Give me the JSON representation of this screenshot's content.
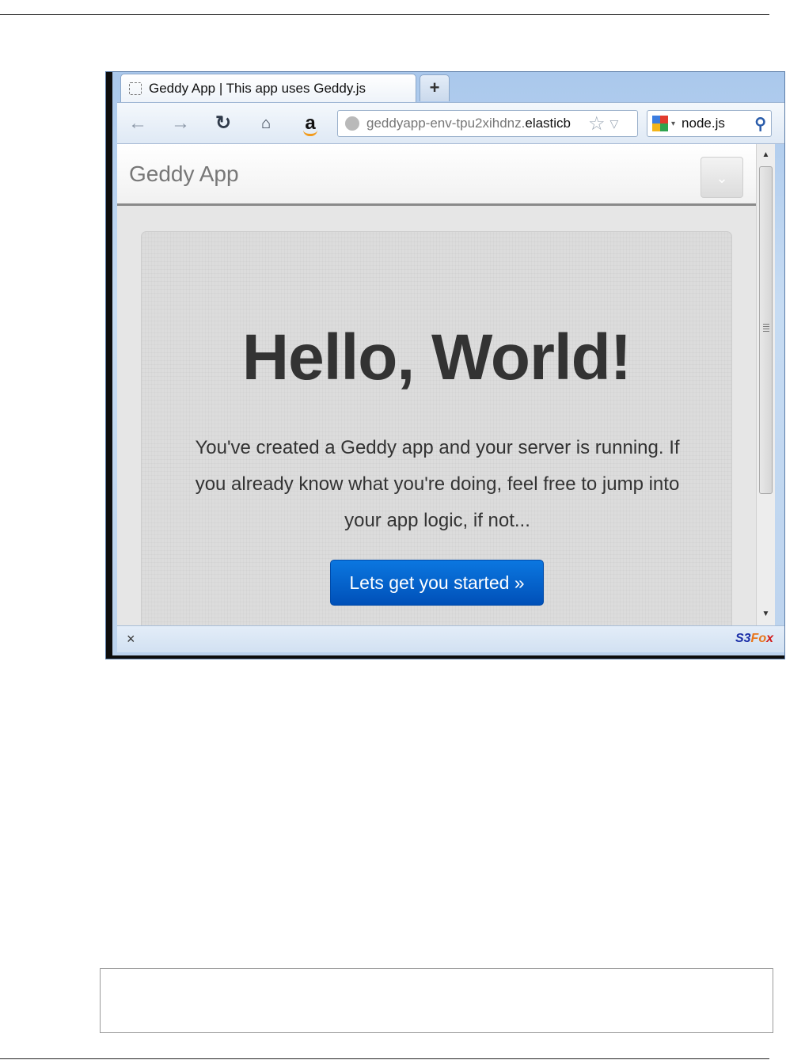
{
  "browser": {
    "tab": {
      "title": "Geddy App | This app uses Geddy.js",
      "favicon": "blank-page-icon"
    },
    "new_tab_label": "+",
    "nav": {
      "back_icon": "←",
      "forward_icon": "→",
      "reload_icon": "↻",
      "home_icon": "⌂",
      "amazon_label": "a"
    },
    "url": {
      "host_prefix": "geddyapp-env-tpu2xihdnz.",
      "host_highlight": "elasticb",
      "star_icon": "☆",
      "dropdown_icon": "▽"
    },
    "search": {
      "value": "node.js",
      "engine_icon": "google-icon",
      "dropdown_icon": "▾",
      "search_icon": "⚲"
    },
    "status": {
      "close_label": "×",
      "addon_s3": "S3",
      "addon_fo": "Fo",
      "addon_x": "x"
    },
    "scrollbar": {
      "up": "▲",
      "down": "▼"
    }
  },
  "page": {
    "brand": "Geddy App",
    "collapse_icon": "⌄",
    "hero": {
      "heading": "Hello, World!",
      "lead": "You've created a Geddy app and your server is running. If you already know what you're doing, feel free to jump into your app logic, if not...",
      "button": "Lets get you started »"
    }
  },
  "colors": {
    "primary_button": "#0b77e0",
    "window_frame": "#aac8ec"
  }
}
